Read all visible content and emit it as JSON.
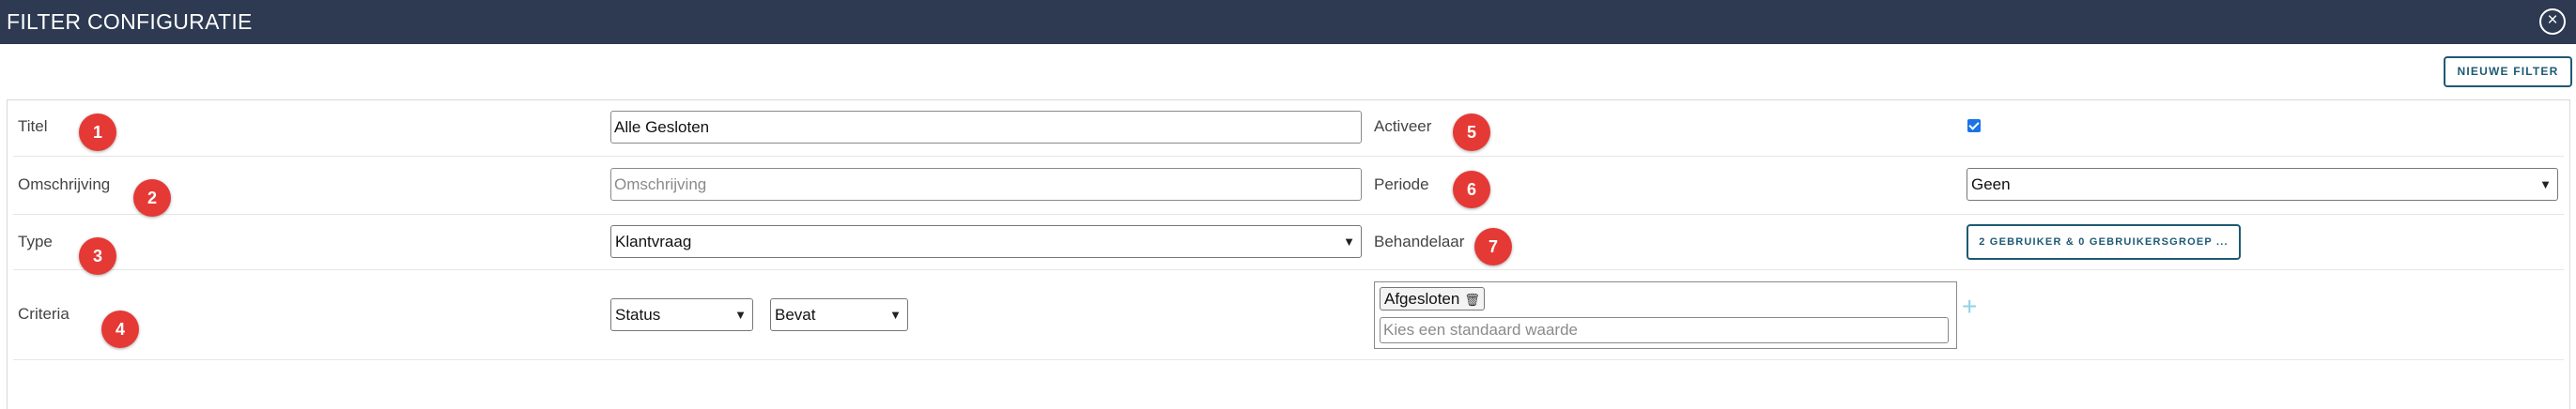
{
  "window": {
    "title": "FILTER CONFIGURATIE",
    "close_symbol": "×",
    "close_icon": "close-circle-icon"
  },
  "toolbar": {
    "new_filter_label": "NIEUWE FILTER"
  },
  "form": {
    "title": {
      "label": "Titel",
      "badge": "1",
      "value": "Alle Gesloten"
    },
    "description": {
      "label": "Omschrijving",
      "badge": "2",
      "placeholder": "Omschrijving"
    },
    "type": {
      "label": "Type",
      "badge": "3",
      "selected": "Klantvraag"
    },
    "criteria": {
      "label": "Criteria",
      "badge": "4",
      "field_selected": "Status",
      "operator_selected": "Bevat",
      "values": [
        "Afgesloten"
      ],
      "value_placeholder": "Kies een standaard waarde",
      "add_symbol": "+"
    },
    "activate": {
      "label": "Activeer",
      "badge": "5",
      "checked": true
    },
    "period": {
      "label": "Periode",
      "badge": "6",
      "selected": "Geen"
    },
    "assignee": {
      "label": "Behandelaar",
      "badge": "7",
      "button_label": "2 GEBRUIKER & 0 GEBRUIKERSGROEP ..."
    }
  },
  "colors": {
    "titlebar": "#2d3a52",
    "badge": "#e53935",
    "accent": "#1d5a73",
    "checkbox": "#1a73e8"
  }
}
